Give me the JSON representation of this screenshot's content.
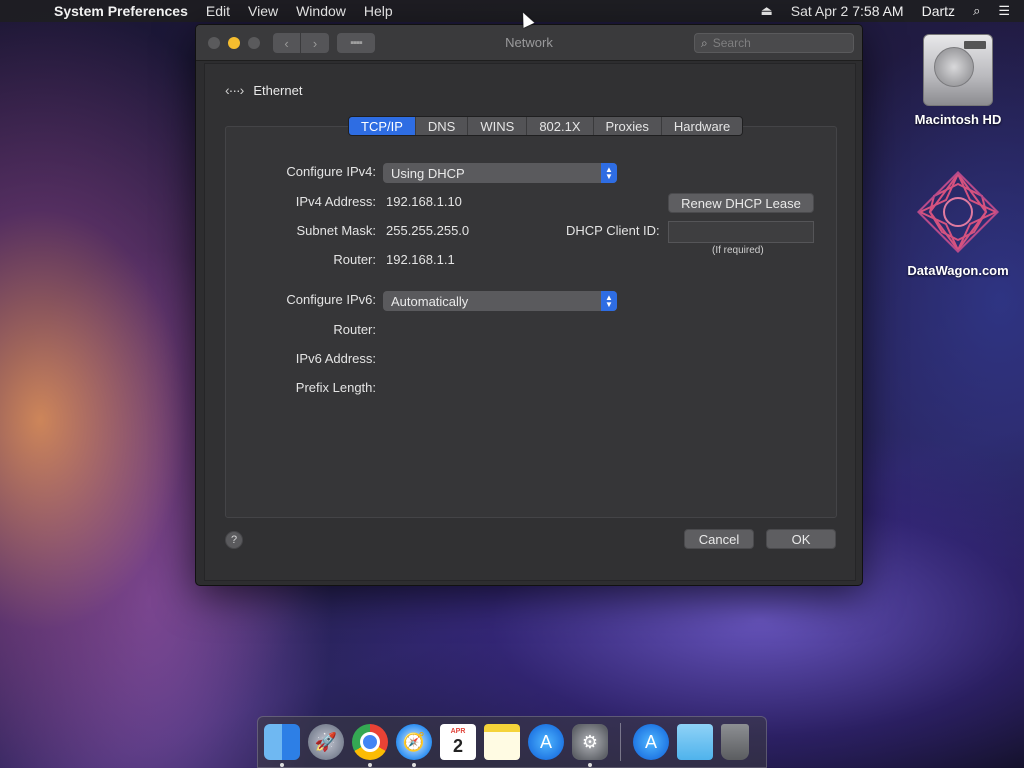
{
  "menubar": {
    "apple": "",
    "app_name": "System Preferences",
    "menus": [
      "Edit",
      "View",
      "Window",
      "Help"
    ],
    "date_time": "Sat Apr 2  7:58 AM",
    "user": "Dartz"
  },
  "window": {
    "title": "Network",
    "search_placeholder": "Search"
  },
  "interface": {
    "name": "Ethernet"
  },
  "tabs": [
    "TCP/IP",
    "DNS",
    "WINS",
    "802.1X",
    "Proxies",
    "Hardware"
  ],
  "active_tab": "TCP/IP",
  "ipv4": {
    "configure_label": "Configure IPv4:",
    "configure_value": "Using DHCP",
    "address_label": "IPv4 Address:",
    "address_value": "192.168.1.10",
    "subnet_label": "Subnet Mask:",
    "subnet_value": "255.255.255.0",
    "router_label": "Router:",
    "router_value": "192.168.1.1",
    "renew_button": "Renew DHCP Lease",
    "client_id_label": "DHCP Client ID:",
    "client_id_value": "",
    "client_id_hint": "(If required)"
  },
  "ipv6": {
    "configure_label": "Configure IPv6:",
    "configure_value": "Automatically",
    "router_label": "Router:",
    "address_label": "IPv6 Address:",
    "prefix_label": "Prefix Length:"
  },
  "buttons": {
    "help": "?",
    "cancel": "Cancel",
    "ok": "OK"
  },
  "desktop": {
    "hd_label": "Macintosh HD",
    "datawagon_label": "DataWagon.com"
  },
  "dock": {
    "calendar_month": "APR",
    "calendar_day": "2"
  },
  "colors": {
    "accent": "#2e6de3",
    "window_bg": "#2d2d2f"
  }
}
